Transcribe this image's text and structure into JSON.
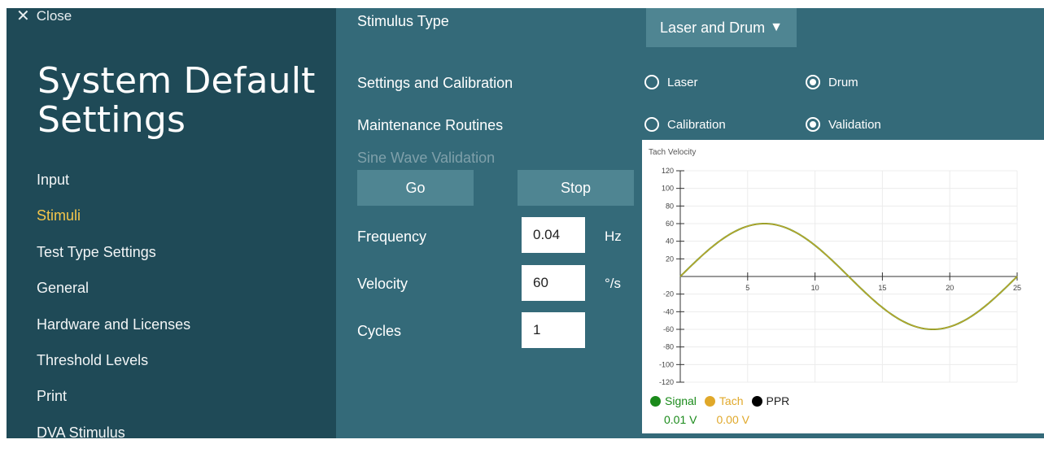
{
  "close": {
    "label": "Close",
    "icon": "close-icon"
  },
  "sidebar": {
    "title": "System Default Settings",
    "items": [
      {
        "label": "Input",
        "active": false
      },
      {
        "label": "Stimuli",
        "active": true
      },
      {
        "label": "Test Type Settings",
        "active": false
      },
      {
        "label": "General",
        "active": false
      },
      {
        "label": "Hardware and Licenses",
        "active": false
      },
      {
        "label": "Threshold Levels",
        "active": false
      },
      {
        "label": "Print",
        "active": false
      },
      {
        "label": "DVA Stimulus",
        "active": false
      }
    ]
  },
  "main": {
    "stimulus_type_label": "Stimulus Type",
    "stimulus_type_value": "Laser and Drum",
    "settings_label": "Settings and Calibration",
    "settings_options": [
      {
        "label": "Laser",
        "selected": false
      },
      {
        "label": "Drum",
        "selected": true
      }
    ],
    "maintenance_label": "Maintenance Routines",
    "maintenance_options": [
      {
        "label": "Calibration",
        "selected": false
      },
      {
        "label": "Validation",
        "selected": true
      }
    ],
    "validation_label": "Sine Wave Validation",
    "go_label": "Go",
    "stop_label": "Stop",
    "frequency": {
      "label": "Frequency",
      "value": "0.04",
      "unit": "Hz"
    },
    "velocity": {
      "label": "Velocity",
      "value": "60",
      "unit": "°/s"
    },
    "cycles": {
      "label": "Cycles",
      "value": "1"
    }
  },
  "colors": {
    "sidebar_bg": "#1f4a57",
    "main_bg": "#346a79",
    "accent": "#f5c64a",
    "button_bg": "#4f8592",
    "signal": "#1a8a1a",
    "tach": "#e0a82a",
    "ppr": "#000000"
  },
  "chart_data": {
    "type": "line",
    "title": "Tach Velocity",
    "xlim": [
      0,
      25
    ],
    "ylim": [
      -120,
      120
    ],
    "xticks": [
      5,
      10,
      15,
      20,
      25
    ],
    "yticks": [
      120,
      100,
      80,
      60,
      40,
      20,
      -20,
      -40,
      -60,
      -80,
      -100,
      -120
    ],
    "grid": true,
    "series": [
      {
        "name": "Signal",
        "color": "#3e9a2a",
        "function": "sine",
        "amplitude": 60,
        "frequency_hz": 0.04,
        "reading": "0.01 V"
      },
      {
        "name": "Tach",
        "color": "#d8a52c",
        "function": "sine",
        "amplitude": 60,
        "frequency_hz": 0.04,
        "reading": "0.00 V"
      },
      {
        "name": "PPR",
        "color": "#000000"
      }
    ],
    "legend_position": "bottom-left"
  }
}
